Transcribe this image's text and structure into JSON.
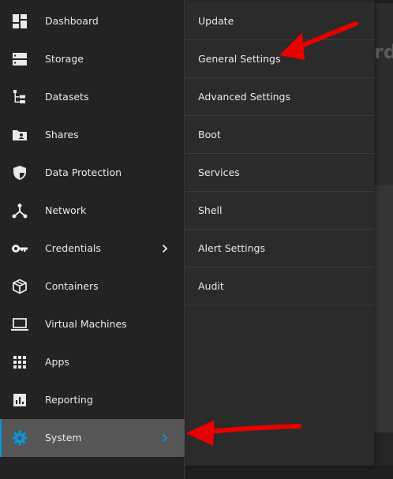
{
  "sidebar": {
    "items": [
      {
        "label": "Dashboard",
        "icon": "dashboard-icon"
      },
      {
        "label": "Storage",
        "icon": "storage-icon"
      },
      {
        "label": "Datasets",
        "icon": "datasets-icon"
      },
      {
        "label": "Shares",
        "icon": "shares-icon"
      },
      {
        "label": "Data Protection",
        "icon": "shield-icon"
      },
      {
        "label": "Network",
        "icon": "network-icon"
      },
      {
        "label": "Credentials",
        "icon": "key-icon"
      },
      {
        "label": "Containers",
        "icon": "cube-icon"
      },
      {
        "label": "Virtual Machines",
        "icon": "laptop-icon"
      },
      {
        "label": "Apps",
        "icon": "apps-grid-icon"
      },
      {
        "label": "Reporting",
        "icon": "chart-icon"
      },
      {
        "label": "System",
        "icon": "gear-icon",
        "active": true
      }
    ]
  },
  "submenu": {
    "items": [
      {
        "label": "Update"
      },
      {
        "label": "General Settings"
      },
      {
        "label": "Advanced Settings"
      },
      {
        "label": "Boot"
      },
      {
        "label": "Services"
      },
      {
        "label": "Shell"
      },
      {
        "label": "Alert Settings"
      },
      {
        "label": "Audit"
      }
    ]
  },
  "background": {
    "heading_fragment": "rd"
  },
  "colors": {
    "accent": "#0a95d8",
    "annotation": "#e60000",
    "sidebar_bg": "#232323",
    "submenu_bg": "#2b2b2b",
    "active_bg": "#565656"
  }
}
